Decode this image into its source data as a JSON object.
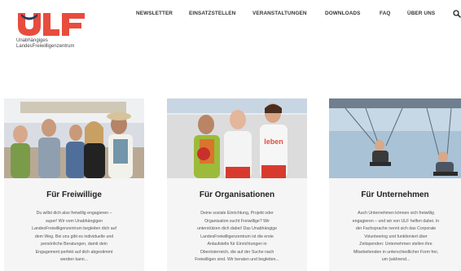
{
  "brand": {
    "logo_text": "ULF",
    "subtitle_lines": [
      "Unabhängiges",
      "LandesFreiwilligenzentrum"
    ],
    "color_red": "#e84c3d",
    "color_navy": "#243a5e"
  },
  "nav": {
    "items": [
      {
        "label": "NEWSLETTER"
      },
      {
        "label": "EINSATZSTELLEN"
      },
      {
        "label": "VERANSTALTUNGEN"
      },
      {
        "label": "DOWNLOADS"
      },
      {
        "label": "FAQ"
      },
      {
        "label": "ÜBER UNS"
      }
    ],
    "search_icon": "search-icon"
  },
  "cards": [
    {
      "title": "Für Freiwillige",
      "lines": [
        "Du willst dich also freiwillig engagieren –",
        "super! Wir vom Unabhängigen",
        "LandesFreiwilligenzentrum begleiten dich auf",
        "dem Weg. Bei uns gibt es individuelle und",
        "persönliche Beratungen, damit dein",
        "Engagement perfekt auf dich abgestimmt",
        "werden kann..."
      ]
    },
    {
      "title": "Für Organisationen",
      "lines": [
        "Deine soziale Einrichtung, Projekt oder",
        "Organisation sucht Freiwillige? Wir",
        "unterstützen dich dabei! Das Unabhängige",
        "LandesFreiwilligenzentrum ist die erste",
        "Anlaufstelle für Einrichtungen in",
        "Oberösterreich, die auf der Suche nach",
        "Freiwilligen sind. Wir beraten und begleiten..."
      ],
      "shirt_text": "leben"
    },
    {
      "title": "Für Unternehmen",
      "lines": [
        "Auch Unternehmen können sich freiwillig",
        "engagieren – und wir von ULF helfen dabei. In",
        "der Fachsprache nennt sich das Corporate",
        "Volunteering und funktioniert über",
        "Zeitspenden: Unternehmen stellen ihre",
        "Mitarbeitenden in unterschiedlicher Form frei,",
        "um (während..."
      ]
    }
  ]
}
